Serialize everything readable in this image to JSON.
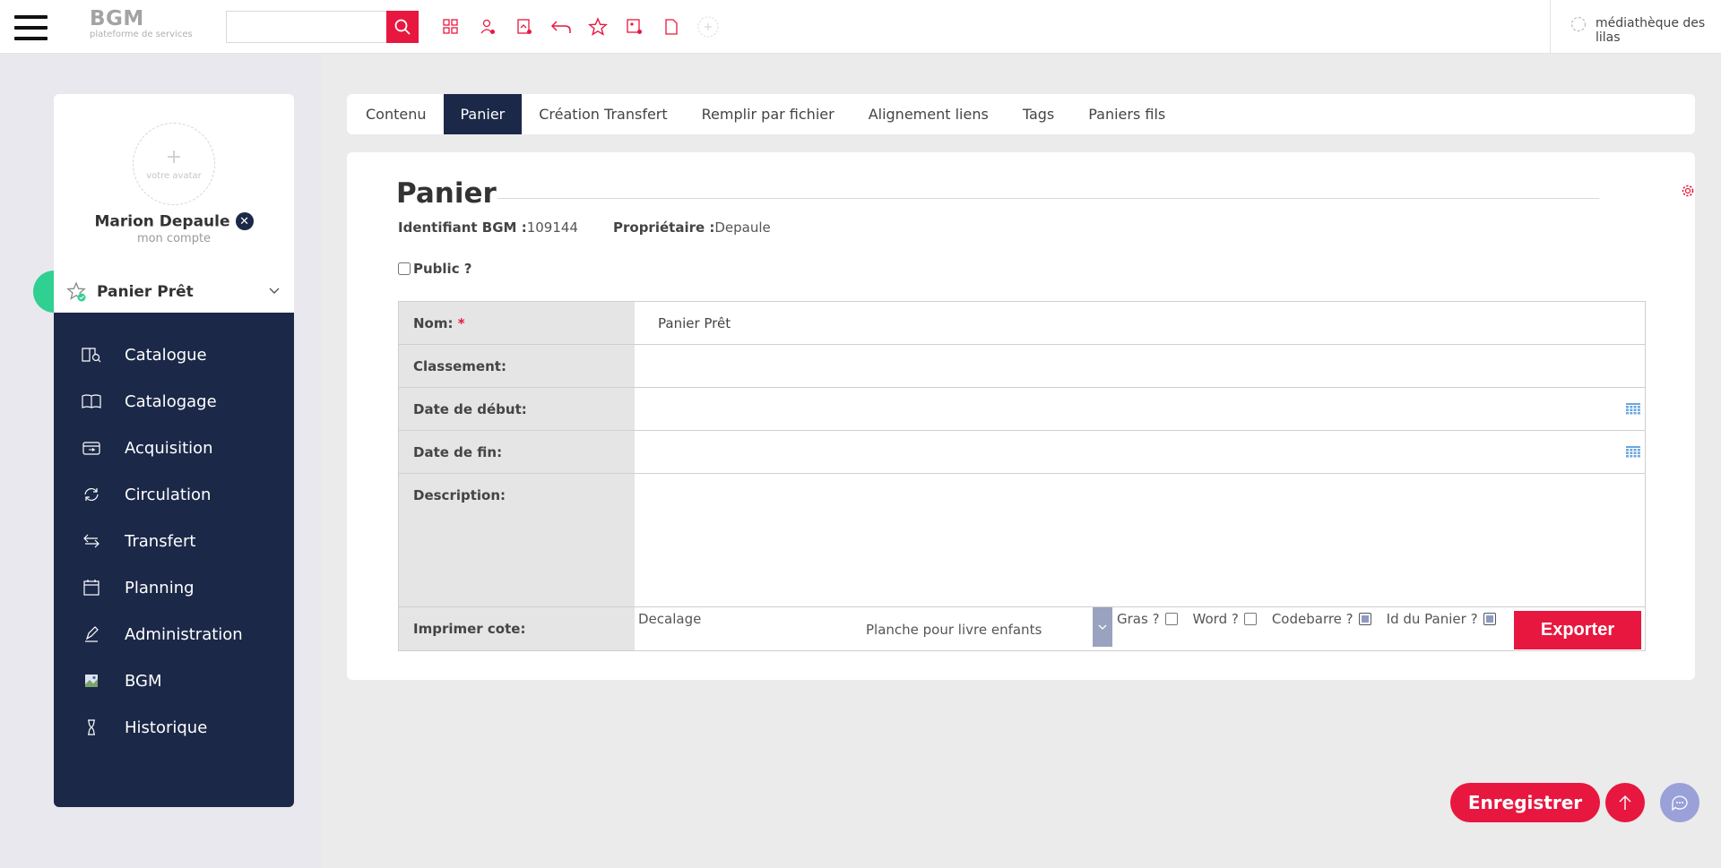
{
  "header": {
    "logo_main": "BGM",
    "logo_sub": "plateforme de services",
    "search_placeholder": "",
    "library": "médiathèque des lilas",
    "accent": "#e8173f",
    "tools": [
      "grid-add-icon",
      "user-add-icon",
      "document-add-icon",
      "undo-icon",
      "star-icon",
      "image-add-icon",
      "page-icon",
      "add-circle-icon"
    ]
  },
  "profile": {
    "avatar_label": "votre avatar",
    "name": "Marion Depaule",
    "sub": "mon compte"
  },
  "basket": {
    "label": "Panier Prêt"
  },
  "nav": {
    "items": [
      {
        "label": "Catalogue",
        "icon": "book-search-icon"
      },
      {
        "label": "Catalogage",
        "icon": "book-open-icon"
      },
      {
        "label": "Acquisition",
        "icon": "inbox-icon"
      },
      {
        "label": "Circulation",
        "icon": "refresh-icon"
      },
      {
        "label": "Transfert",
        "icon": "swap-icon"
      },
      {
        "label": "Planning",
        "icon": "calendar-icon"
      },
      {
        "label": "Administration",
        "icon": "pen-icon"
      },
      {
        "label": "BGM",
        "icon": "broken-image-icon"
      },
      {
        "label": "Historique",
        "icon": "hourglass-icon"
      }
    ],
    "bg_color": "#1b2848"
  },
  "tabs": [
    {
      "label": "Contenu"
    },
    {
      "label": "Panier"
    },
    {
      "label": "Création Transfert"
    },
    {
      "label": "Remplir par fichier"
    },
    {
      "label": "Alignement liens"
    },
    {
      "label": "Tags"
    },
    {
      "label": "Paniers fils"
    }
  ],
  "panel": {
    "title": "Panier",
    "id_label": "Identifiant BGM :",
    "id_value": "109144",
    "owner_label": "Propriétaire :",
    "owner_value": "Depaule",
    "public_label": "Public ?",
    "fields": {
      "nom_label": "Nom:",
      "nom_required": "*",
      "nom_value": "Panier Prêt",
      "classement_label": "Classement:",
      "classement_value": "",
      "debut_label": "Date de début:",
      "debut_value": "",
      "fin_label": "Date de fin:",
      "fin_value": "",
      "description_label": "Description:",
      "description_value": "",
      "imprimer_label": "Imprimer cote:"
    },
    "print": {
      "decalage_label": "Decalage",
      "planche_value": "Planche pour livre enfants",
      "gras_label": "Gras ?",
      "word_label": "Word ?",
      "codebarre_label": "Codebarre ?",
      "id_panier_label": "Id du Panier ?",
      "export_label": "Exporter"
    }
  },
  "actions": {
    "save_label": "Enregistrer"
  }
}
